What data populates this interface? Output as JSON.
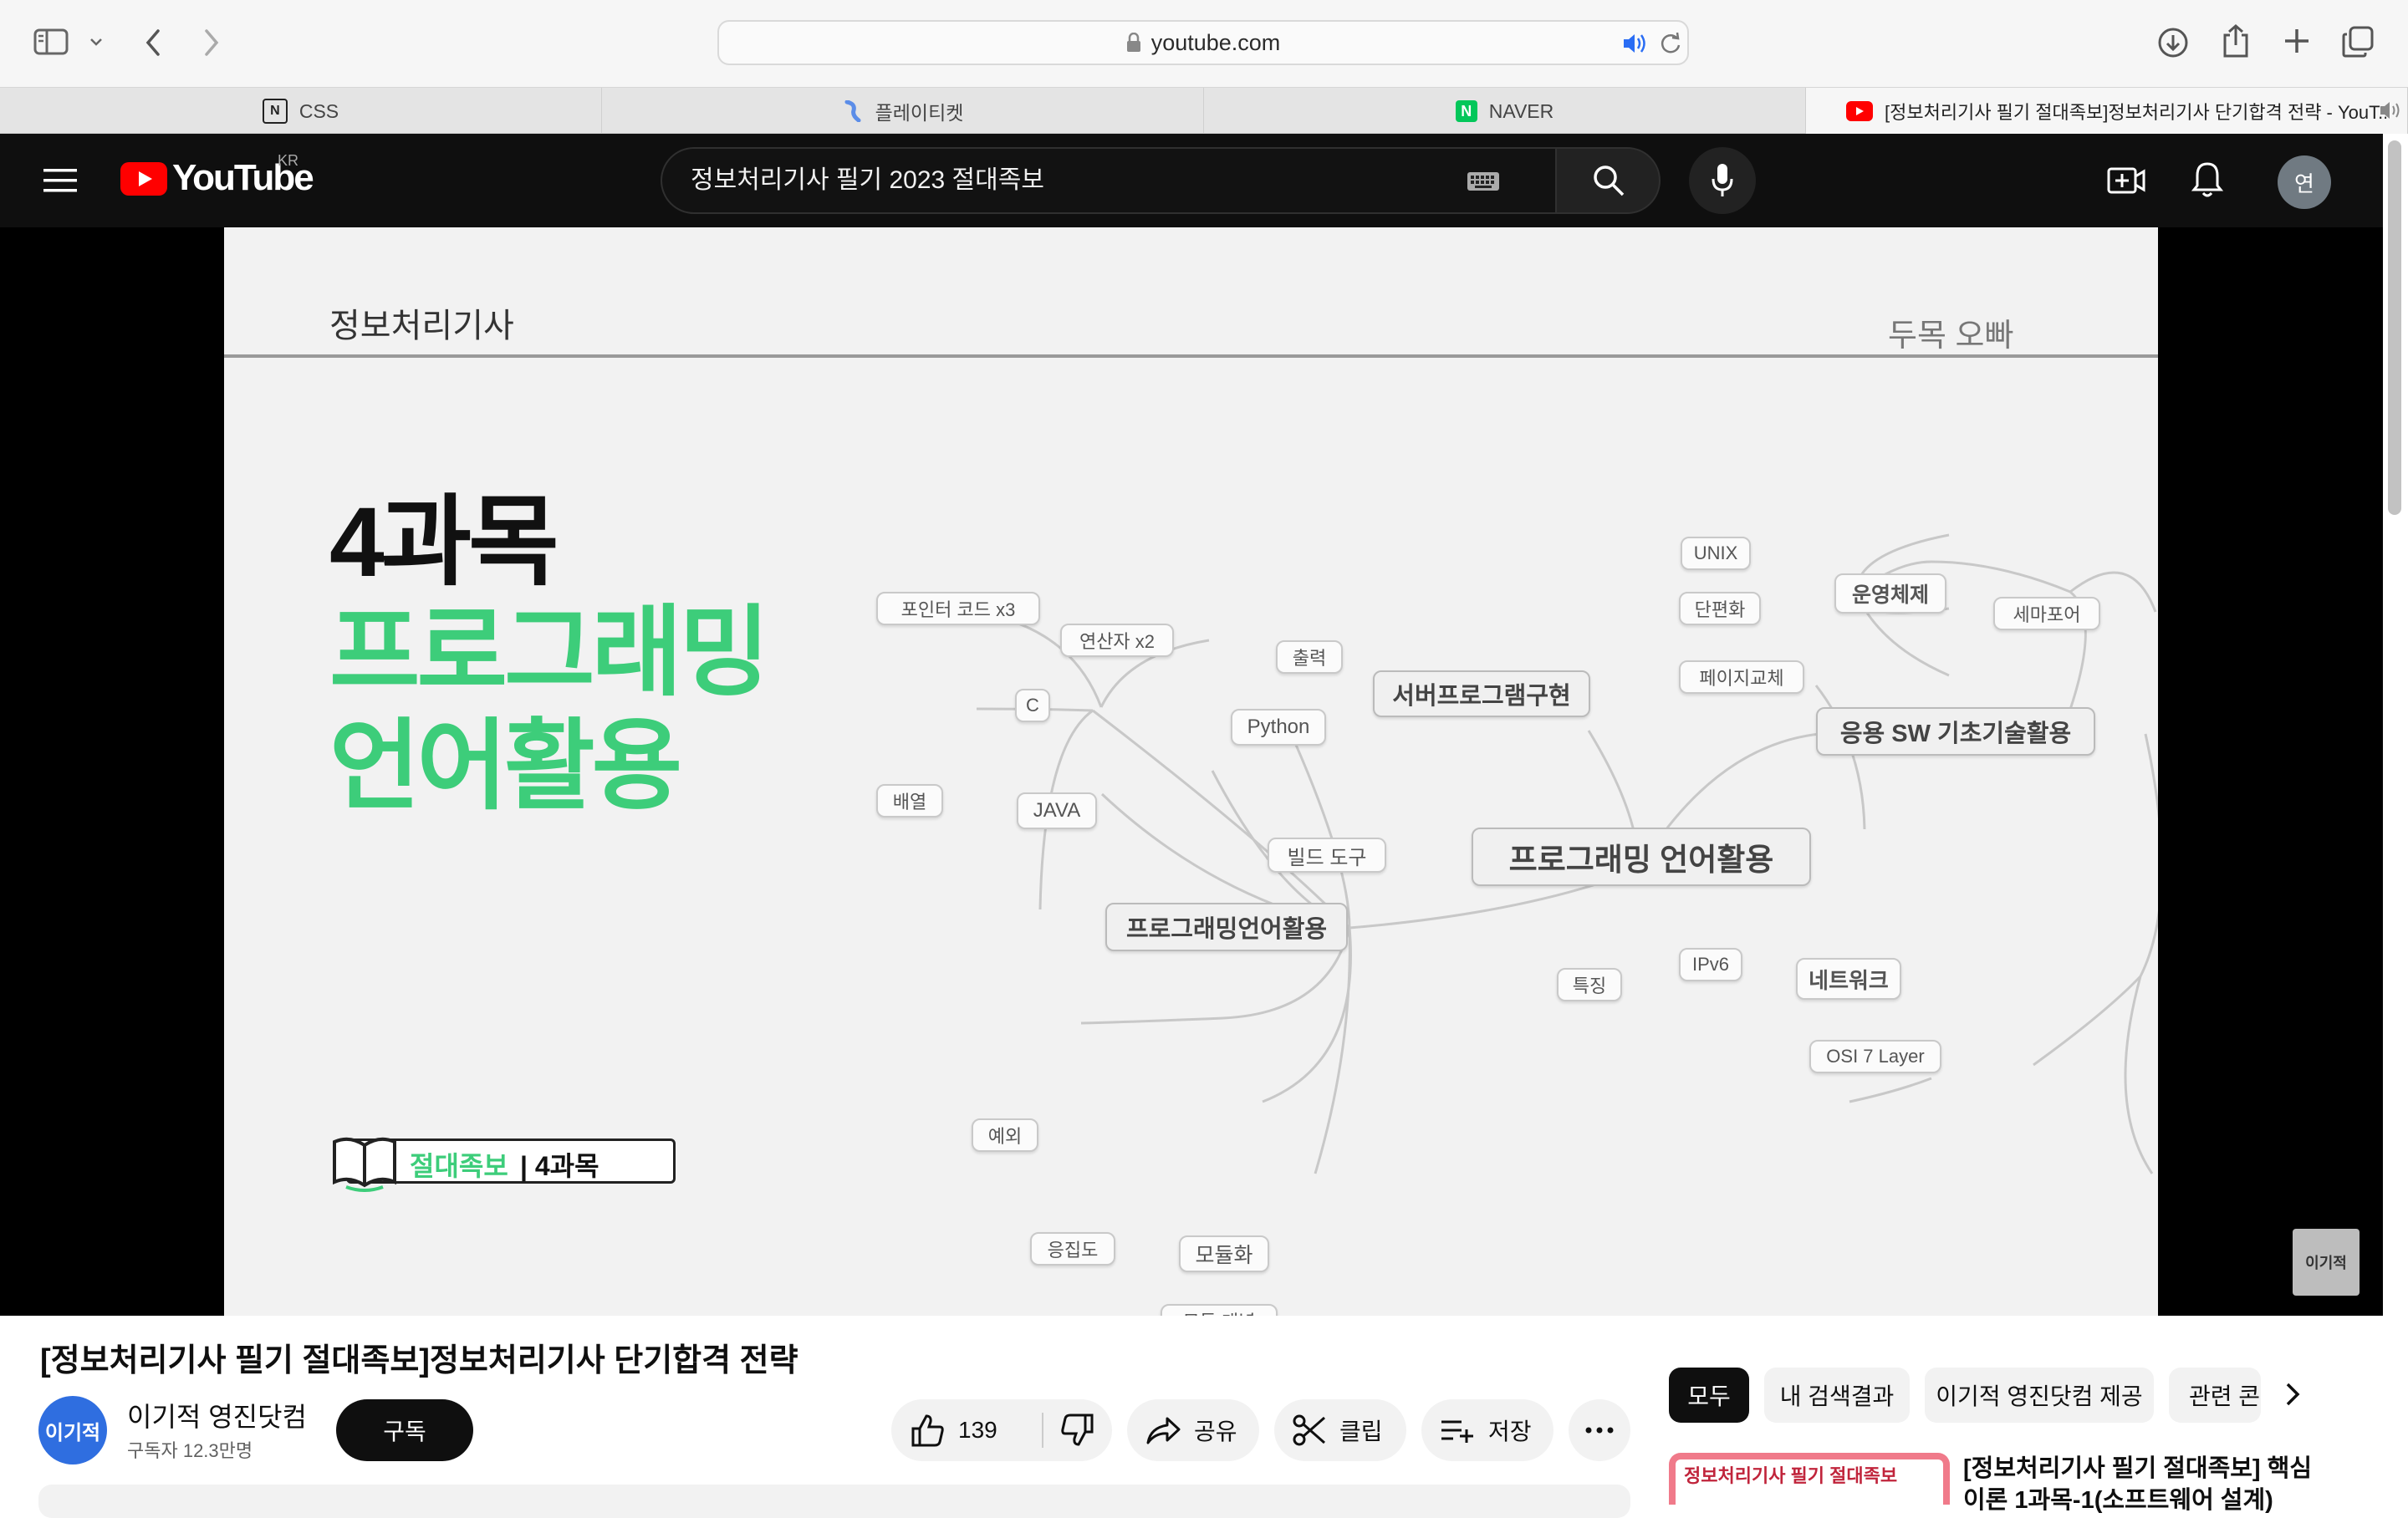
{
  "browser": {
    "url": "youtube.com",
    "tabs": [
      {
        "label": "CSS",
        "icon": "notion-icon"
      },
      {
        "label": "플레이티켓",
        "icon": "playticket-icon"
      },
      {
        "label": "NAVER",
        "icon": "naver-icon",
        "icon_text": "N"
      },
      {
        "label": "[정보처리기사 필기 절대족보]정보처리기사 단기합격 전략 - YouT...",
        "icon": "youtube-icon"
      }
    ],
    "colors": {
      "naver": "#03c75a",
      "youtube_red": "#ff0000"
    }
  },
  "youtube": {
    "logo_text": "YouTube",
    "logo_region": "KR",
    "search_query": "정보처리기사 필기 2023 절대족보",
    "avatar_letter": "연"
  },
  "slide": {
    "subject": "정보처리기사",
    "author": "두목 오빠",
    "heading_line1": "4과목",
    "heading_line2": "프로그래밍",
    "heading_line3": "언어활용",
    "badge_green": "절대족보",
    "badge_dark": "| 4과목",
    "watermark": "이기적",
    "accent_color": "#3dcd7a",
    "mindmap": {
      "central": "프로그래밍 언어활용",
      "branch_server": "서버프로그램구현",
      "branch_os": "운영체제",
      "branch_sw": "응용 SW 기초기술활용",
      "branch_network": "네트워크",
      "branch_prog": "프로그래밍언어활용",
      "unix": "UNIX",
      "fragment": "단편화",
      "page_replace": "페이지교체",
      "semaphore": "세마포어",
      "ipv6": "IPv6",
      "osi": "OSI 7 Layer",
      "feature": "특징",
      "pointer": "포인터 코드 x3",
      "operator": "연산자 x2",
      "c": "C",
      "output": "출력",
      "python": "Python",
      "array": "배열",
      "java": "JAVA",
      "build_tool": "빌드 도구",
      "exception": "예외",
      "cohesion": "응집도",
      "modularization": "모듈화",
      "module_concept": "모듈 개념"
    }
  },
  "video": {
    "title": "[정보처리기사 필기 절대족보]정보처리기사 단기합격 전략",
    "channel_name": "이기적 영진닷컴",
    "channel_avatar_text": "이기적",
    "subscribers": "구독자 12.3만명",
    "subscribe_label": "구독",
    "likes": "139",
    "share_label": "공유",
    "clip_label": "클립",
    "save_label": "저장"
  },
  "sidebar": {
    "chips": [
      "모두",
      "내 검색결과",
      "이기적 영진닷컴 제공",
      "관련 콘"
    ],
    "recommendation": {
      "thumb_text": "정보처리기사 필기 절대족보",
      "title": "[정보처리기사 필기 절대족보] 핵심이론 1과목-1(소프트웨어 설계)"
    }
  }
}
